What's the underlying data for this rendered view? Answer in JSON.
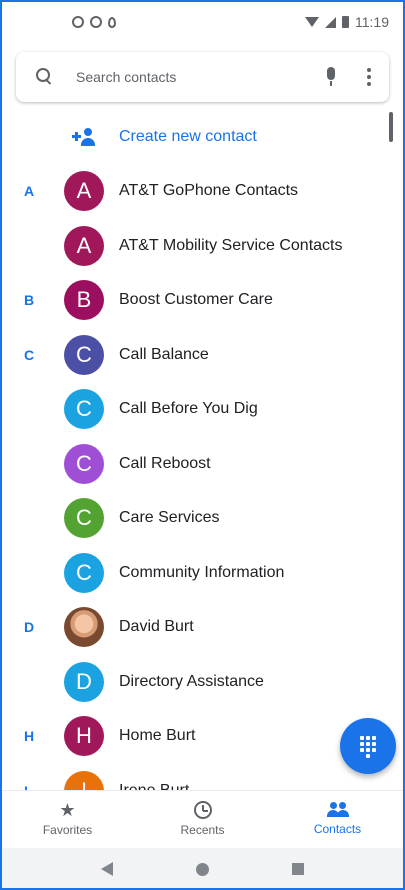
{
  "status_bar": {
    "time": "11:19",
    "left_icons": [
      "data-saver-icon",
      "globe-icon",
      "location-icon"
    ],
    "right_icons": [
      "wifi-icon",
      "signal-icon",
      "battery-icon"
    ]
  },
  "search": {
    "placeholder": "Search contacts",
    "icons": [
      "search-icon",
      "mic-icon",
      "more-vert-icon"
    ]
  },
  "create_contact": {
    "label": "Create new contact",
    "icon": "add-person-icon",
    "color": "#1a73e8"
  },
  "contacts": [
    {
      "letter": "A",
      "initial": "A",
      "name": "AT&T GoPhone Contacts",
      "color": "#a0185a"
    },
    {
      "letter": "",
      "initial": "A",
      "name": "AT&T Mobility Service Contacts",
      "color": "#a0185a"
    },
    {
      "letter": "B",
      "initial": "B",
      "name": "Boost Customer Care",
      "color": "#9c0f5f"
    },
    {
      "letter": "C",
      "initial": "C",
      "name": "Call Balance",
      "color": "#4b4fa6"
    },
    {
      "letter": "",
      "initial": "C",
      "name": "Call Before You Dig",
      "color": "#1aa3e0"
    },
    {
      "letter": "",
      "initial": "C",
      "name": "Call Reboost",
      "color": "#9e4fd6"
    },
    {
      "letter": "",
      "initial": "C",
      "name": "Care Services",
      "color": "#53a332"
    },
    {
      "letter": "",
      "initial": "C",
      "name": "Community Information",
      "color": "#1aa3e0"
    },
    {
      "letter": "D",
      "initial": "",
      "name": "David Burt",
      "color": "photo"
    },
    {
      "letter": "",
      "initial": "D",
      "name": "Directory Assistance",
      "color": "#1aa3e0"
    },
    {
      "letter": "H",
      "initial": "H",
      "name": "Home Burt",
      "color": "#a0185a"
    },
    {
      "letter": "I",
      "initial": "I",
      "name": "Irene Burt",
      "color": "#e8710a"
    }
  ],
  "fab": {
    "icon": "dialpad-icon",
    "color": "#1a73e8"
  },
  "bottom_nav": {
    "tabs": [
      {
        "label": "Favorites",
        "icon": "star-icon",
        "active": false
      },
      {
        "label": "Recents",
        "icon": "clock-icon",
        "active": false
      },
      {
        "label": "Contacts",
        "icon": "people-icon",
        "active": true
      }
    ]
  },
  "system_nav": {
    "icons": [
      "back-icon",
      "home-icon",
      "recents-icon"
    ]
  }
}
